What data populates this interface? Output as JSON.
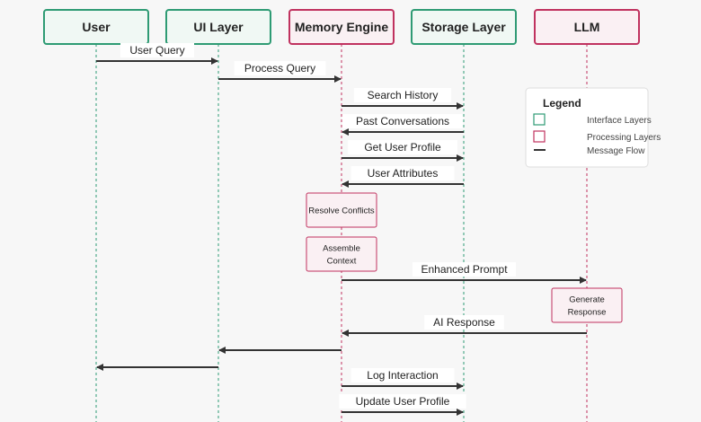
{
  "colors": {
    "interface": "#2e9b74",
    "processing": "#c0325f",
    "interface_fill": "#f0f8f4",
    "processing_fill": "#faf0f3",
    "message": "#333333"
  },
  "participants": [
    {
      "id": "user",
      "label": "User",
      "kind": "interface"
    },
    {
      "id": "ui",
      "label": "UI Layer",
      "kind": "interface"
    },
    {
      "id": "memory",
      "label": "Memory Engine",
      "kind": "processing"
    },
    {
      "id": "storage",
      "label": "Storage Layer",
      "kind": "interface"
    },
    {
      "id": "llm",
      "label": "LLM",
      "kind": "processing"
    }
  ],
  "steps": [
    {
      "type": "message",
      "from": "user",
      "to": "ui",
      "label": "User Query"
    },
    {
      "type": "message",
      "from": "ui",
      "to": "memory",
      "label": "Process Query"
    },
    {
      "type": "message",
      "from": "memory",
      "to": "storage",
      "label": "Search History"
    },
    {
      "type": "message",
      "from": "storage",
      "to": "memory",
      "label": "Past Conversations"
    },
    {
      "type": "message",
      "from": "memory",
      "to": "storage",
      "label": "Get User Profile"
    },
    {
      "type": "message",
      "from": "storage",
      "to": "memory",
      "label": "User Attributes"
    },
    {
      "type": "note",
      "on": "memory",
      "lines": [
        "Resolve Conflicts"
      ]
    },
    {
      "type": "note",
      "on": "memory",
      "lines": [
        "Assemble",
        "Context"
      ]
    },
    {
      "type": "message",
      "from": "memory",
      "to": "llm",
      "label": "Enhanced Prompt"
    },
    {
      "type": "note",
      "on": "llm",
      "lines": [
        "Generate",
        "Response"
      ]
    },
    {
      "type": "message",
      "from": "llm",
      "to": "memory",
      "label": "AI Response"
    },
    {
      "type": "message",
      "from": "memory",
      "to": "ui",
      "label": ""
    },
    {
      "type": "message",
      "from": "ui",
      "to": "user",
      "label": ""
    },
    {
      "type": "message",
      "from": "memory",
      "to": "storage",
      "label": "Log Interaction"
    },
    {
      "type": "message",
      "from": "memory",
      "to": "storage",
      "label": "Update User Profile"
    }
  ],
  "legend": {
    "title": "Legend",
    "items": [
      {
        "kind": "interface",
        "label": "Interface Layers"
      },
      {
        "kind": "processing",
        "label": "Processing Layers"
      },
      {
        "kind": "message",
        "label": "Message Flow"
      }
    ]
  }
}
